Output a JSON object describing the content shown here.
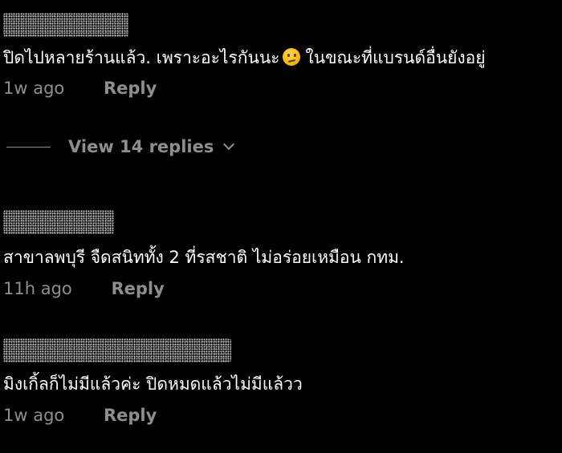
{
  "comments": [
    {
      "username_redacted": true,
      "text_before": "ปิดไปหลายร้านแล้ว. เพราะอะไรกันนะ",
      "emoji": "thinking-face",
      "text_after": "ในขณะที่แบรนด์อื่นยังอยู่",
      "time": "1w ago",
      "reply_label": "Reply",
      "view_replies_label": "View 14 replies"
    },
    {
      "username_redacted": true,
      "text": "สาขาลพบุรี จืดสนิททั้ง 2 ที่รสชาติ ไม่อร่อยเหมือน กทม.",
      "time": "11h ago",
      "reply_label": "Reply"
    },
    {
      "username_redacted": true,
      "text": "มิงเกิ้ลก็ไม่มีแล้วค่ะ ปิดหมดแล้วไม่มีแล้วว",
      "time": "1w ago",
      "reply_label": "Reply"
    }
  ],
  "colors": {
    "background": "#000000",
    "text": "#ffffff",
    "meta": "#8e8e8e",
    "emoji": "#f5b400"
  }
}
